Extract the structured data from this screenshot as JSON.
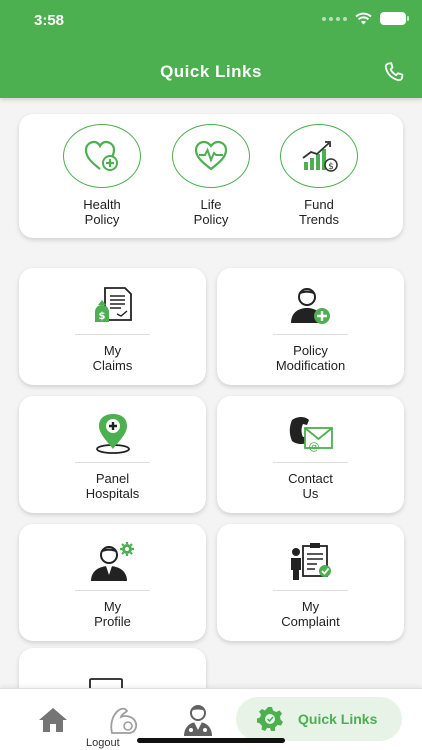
{
  "status_bar": {
    "time": "3:58"
  },
  "header": {
    "title": "Quick Links"
  },
  "policies": [
    {
      "line1": "Health",
      "line2": "Policy"
    },
    {
      "line1": "Life",
      "line2": "Policy"
    },
    {
      "line1": "Fund",
      "line2": "Trends"
    }
  ],
  "tiles": [
    {
      "line1": "My",
      "line2": "Claims"
    },
    {
      "line1": "Policy",
      "line2": "Modification"
    },
    {
      "line1": "Panel",
      "line2": "Hospitals"
    },
    {
      "line1": "Contact",
      "line2": "Us"
    },
    {
      "line1": "My",
      "line2": "Profile"
    },
    {
      "line1": "My",
      "line2": "Complaint"
    }
  ],
  "logout": {
    "label": "Logout"
  },
  "bottom_nav": {
    "active_label": "Quick Links"
  },
  "colors": {
    "accent": "#4caf50",
    "background": "#f4f4f4"
  }
}
